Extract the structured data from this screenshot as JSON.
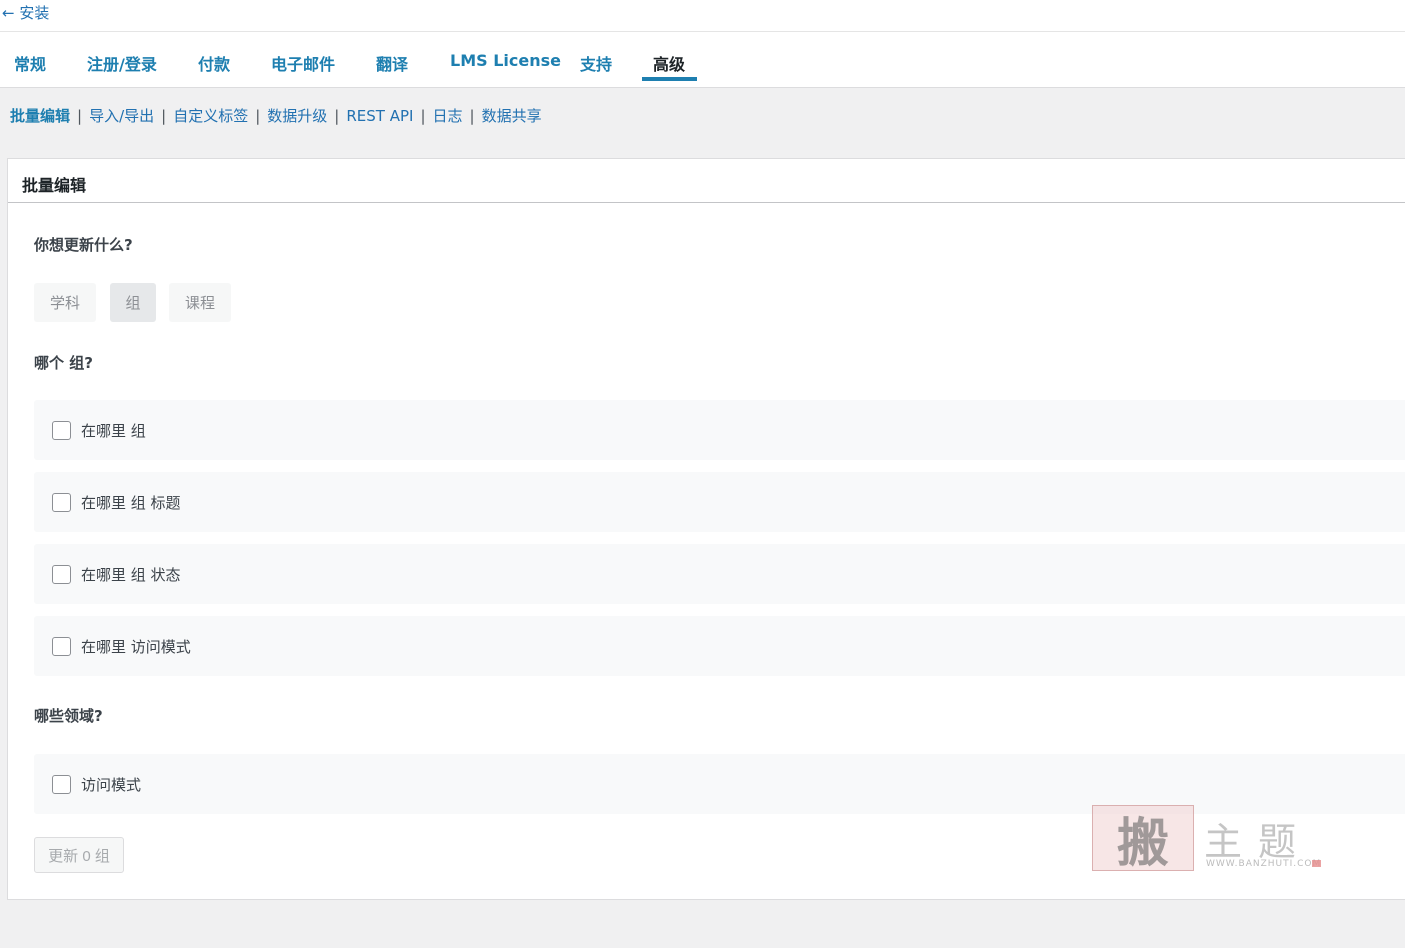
{
  "back_link": "← 安装",
  "tabs": [
    {
      "label": "常规"
    },
    {
      "label": "注册/登录"
    },
    {
      "label": "付款"
    },
    {
      "label": "电子邮件"
    },
    {
      "label": "翻译"
    },
    {
      "label": "LMS License"
    },
    {
      "label": "支持"
    },
    {
      "label": "高级",
      "active": true
    }
  ],
  "subnav": [
    {
      "label": "批量编辑",
      "current": true
    },
    {
      "label": "导入/导出"
    },
    {
      "label": "自定义标签"
    },
    {
      "label": "数据升级"
    },
    {
      "label": "REST API"
    },
    {
      "label": "日志"
    },
    {
      "label": "数据共享"
    }
  ],
  "panel": {
    "title": "批量编辑",
    "question_update": "你想更新什么?",
    "types": [
      {
        "label": "学科"
      },
      {
        "label": "组",
        "selected": true
      },
      {
        "label": "课程"
      }
    ],
    "question_which": "哪个 组?",
    "which_options": [
      {
        "label": "在哪里 组",
        "checked": false
      },
      {
        "label": "在哪里 组 标题",
        "checked": false
      },
      {
        "label": "在哪里 组 状态",
        "checked": false
      },
      {
        "label": "在哪里 访问模式",
        "checked": false
      }
    ],
    "question_fields": "哪些领域?",
    "field_options": [
      {
        "label": "访问模式",
        "checked": false
      }
    ],
    "update_button": "更新 0 组"
  },
  "watermark": {
    "mark": "搬",
    "text": "主题",
    "url": "WWW.BANZHUTI.COM"
  },
  "colors": {
    "link": "#2271b1",
    "tab": "#1e7fb0",
    "active_underline": "#1e7fb0",
    "background": "#f0f0f1"
  }
}
